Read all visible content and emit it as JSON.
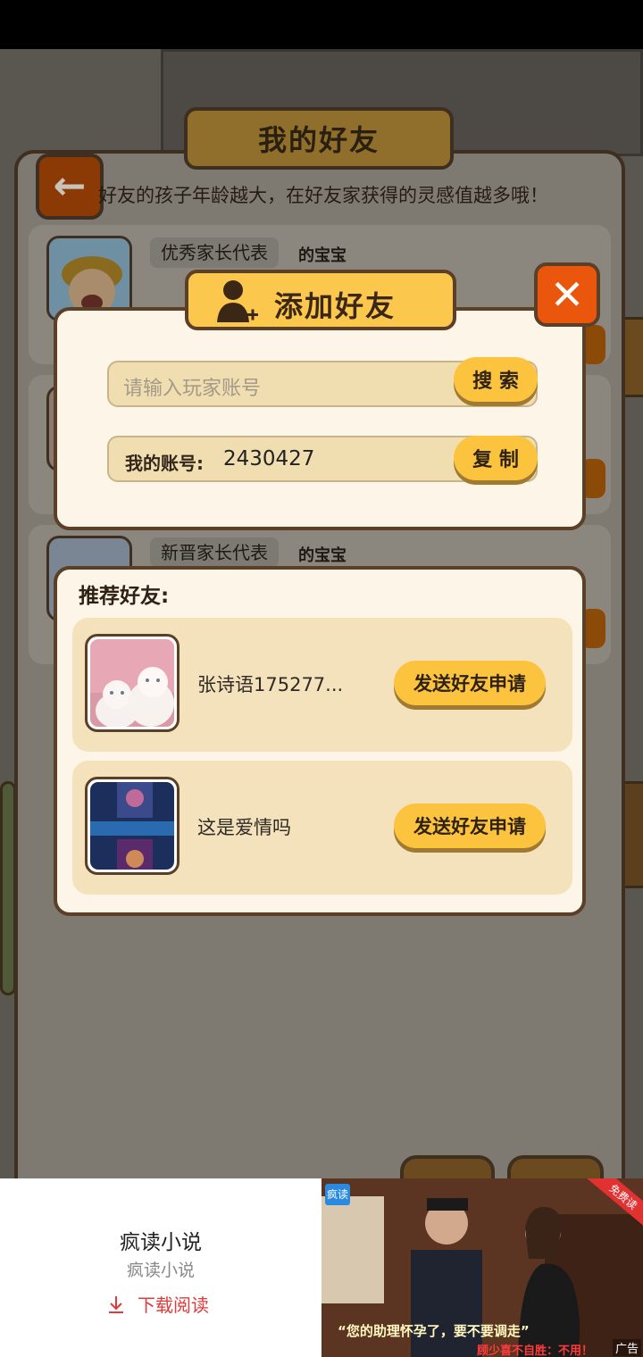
{
  "friends_panel": {
    "title": "我的好友",
    "hint": "好友的孩子年龄越大，在好友家获得的灵感值越多哦！",
    "friends": [
      {
        "parent_name": "优秀家长代表",
        "baby_label": "的宝宝"
      },
      {
        "parent_name": "新晋家长代表",
        "baby_label": "的宝宝"
      }
    ]
  },
  "add_friend_dialog": {
    "title": "添加好友",
    "search_placeholder": "请输入玩家账号",
    "search_button": "搜 索",
    "my_account_label": "我的账号:",
    "my_account_value": "2430427",
    "copy_button": "复 制",
    "close_label": "✕",
    "recommend_title": "推荐好友:",
    "recommended": [
      {
        "name": "张诗语175277...",
        "button": "发送好友申请"
      },
      {
        "name": "这是爱情吗",
        "button": "发送好友申请"
      }
    ]
  },
  "ad": {
    "app_name": "疯读小说",
    "app_sub": "疯读小说",
    "download_label": "下载阅读",
    "logo_text": "疯读",
    "caption": "“您的助理怀孕了，要不要调走”",
    "caption2": "顾少喜不自胜：不用！",
    "ribbon": "免费读",
    "tag": "广告"
  },
  "colors": {
    "dialog_bg": "#fdf6e8",
    "dialog_border": "#5b3f27",
    "button_yellow": "#fcc43e",
    "close_orange": "#e9560c",
    "field_bg": "#f0deb1"
  }
}
